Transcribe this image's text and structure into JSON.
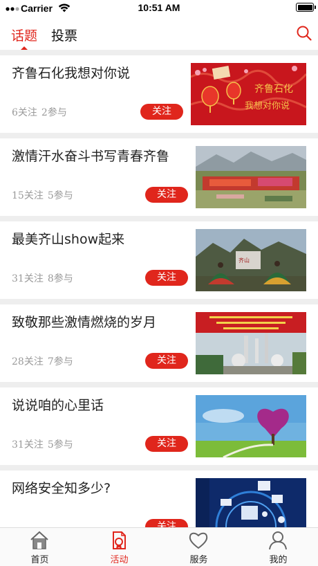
{
  "status_bar": {
    "carrier": "Carrier",
    "time": "10:51 AM"
  },
  "header": {
    "tabs": [
      {
        "label": "话题",
        "active": true
      },
      {
        "label": "投票",
        "active": false
      }
    ],
    "search_icon": "search-icon"
  },
  "topics": [
    {
      "title": "齐鲁石化我想对你说",
      "follows": "6关注",
      "participants": "2参与",
      "follow_label": "关注",
      "thumb_text_1": "齐鲁石化",
      "thumb_text_2": "我想对你说"
    },
    {
      "title": "激情汗水奋斗书写青春齐鲁",
      "follows": "15关注",
      "participants": "5参与",
      "follow_label": "关注"
    },
    {
      "title": "最美齐山show起来",
      "follows": "31关注",
      "participants": "8参与",
      "follow_label": "关注"
    },
    {
      "title": "致敬那些激情燃烧的岁月",
      "follows": "28关注",
      "participants": "7参与",
      "follow_label": "关注"
    },
    {
      "title": "说说咱的心里话",
      "follows": "31关注",
      "participants": "5参与",
      "follow_label": "关注"
    },
    {
      "title": "网络安全知多少?",
      "follows": "",
      "participants": "",
      "follow_label": "关注"
    }
  ],
  "tabbar": {
    "items": [
      {
        "label": "首页",
        "icon": "home-icon",
        "active": false
      },
      {
        "label": "活动",
        "icon": "activity-icon",
        "active": true
      },
      {
        "label": "服务",
        "icon": "heart-icon",
        "active": false
      },
      {
        "label": "我的",
        "icon": "person-icon",
        "active": false
      }
    ]
  },
  "colors": {
    "accent": "#e0261c",
    "separator": "#eeeeee",
    "muted_text": "#9a9a9a"
  }
}
